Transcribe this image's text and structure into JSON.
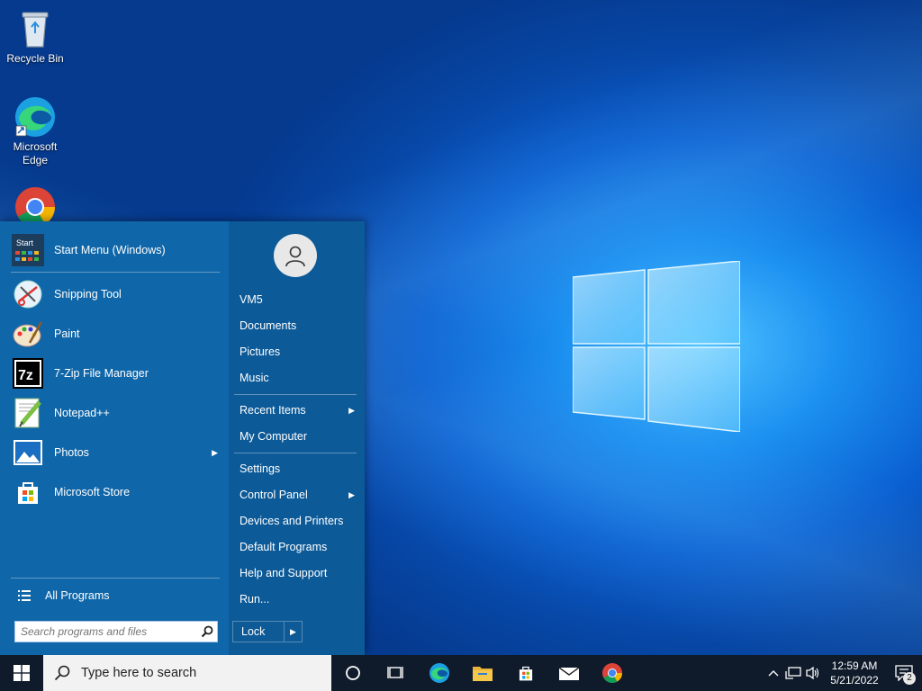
{
  "desktop": {
    "icons": [
      {
        "label": "Recycle Bin"
      },
      {
        "label": "Microsoft Edge"
      }
    ]
  },
  "start_menu": {
    "programs": [
      {
        "label": "Start Menu (Windows)",
        "icon": "start-menu-icon",
        "start_badge": "Start"
      },
      {
        "label": "Snipping Tool",
        "icon": "snipping-tool-icon"
      },
      {
        "label": "Paint",
        "icon": "paint-icon"
      },
      {
        "label": "7-Zip File Manager",
        "icon": "seven-zip-icon",
        "badge": "7z"
      },
      {
        "label": "Notepad++",
        "icon": "notepad-plus-plus-icon"
      },
      {
        "label": "Photos",
        "icon": "photos-icon"
      },
      {
        "label": "Microsoft Store",
        "icon": "store-icon"
      }
    ],
    "all_programs": "All Programs",
    "search_placeholder": "Search programs and files",
    "right_items": {
      "user": "VM5",
      "documents": "Documents",
      "pictures": "Pictures",
      "music": "Music",
      "recent_items": "Recent Items",
      "my_computer": "My Computer",
      "settings": "Settings",
      "control_panel": "Control Panel",
      "devices_printers": "Devices and Printers",
      "default_programs": "Default Programs",
      "help_support": "Help and Support",
      "run": "Run..."
    },
    "lock_label": "Lock"
  },
  "taskbar": {
    "search_placeholder": "Type here to search",
    "pinned": [
      "cortana-icon",
      "task-view-icon",
      "edge-icon",
      "file-explorer-icon",
      "store-icon",
      "mail-icon",
      "chrome-icon"
    ],
    "clock_time": "12:59 AM",
    "clock_date": "5/21/2022",
    "notification_count": "2"
  },
  "colors": {
    "menu_left": "#0f66a8",
    "menu_right": "#0c5a98",
    "taskbar": "#0f1a2a",
    "desktop_center": "#4fc3ff"
  }
}
